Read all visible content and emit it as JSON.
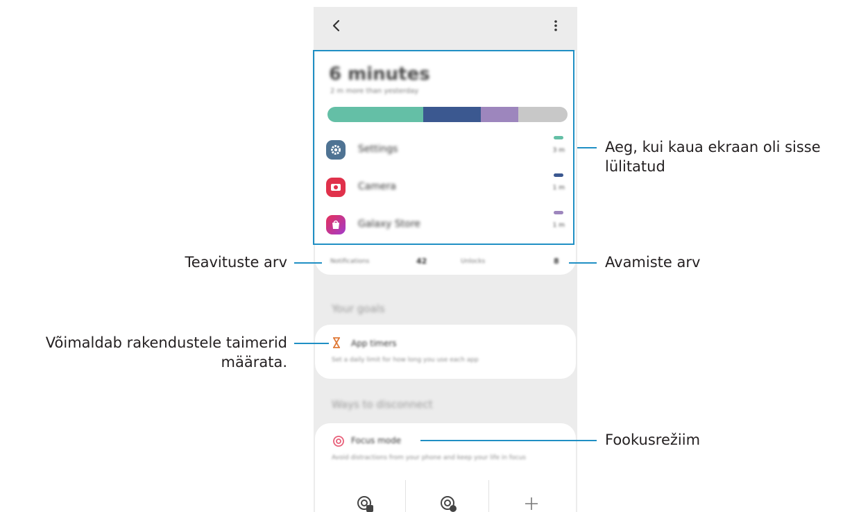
{
  "usage": {
    "total": "6 minutes",
    "compare": "2 m more than yesterday",
    "bar": [
      {
        "color": "#64bfa6",
        "fraction": 0.4
      },
      {
        "color": "#3b5890",
        "fraction": 0.24
      },
      {
        "color": "#9d86bd",
        "fraction": 0.155
      },
      {
        "color": "#c8c8c8",
        "fraction": 0.205
      }
    ]
  },
  "apps": [
    {
      "name": "Settings",
      "time": "3 m",
      "color": "#64bfa6",
      "icon": "gear-icon"
    },
    {
      "name": "Camera",
      "time": "1 m",
      "color": "#3b5890",
      "icon": "camera-icon"
    },
    {
      "name": "Galaxy Store",
      "time": "1 m",
      "color": "#9d86bd",
      "icon": "shopping-bag-icon"
    }
  ],
  "stats": {
    "notifications_label": "Notifications",
    "notifications_value": "42",
    "unlocks_label": "Unlocks",
    "unlocks_value": "8"
  },
  "goals": {
    "section": "Your goals",
    "app_timers_title": "App timers",
    "app_timers_desc": "Set a daily limit for how long you use each app"
  },
  "disconnect": {
    "section": "Ways to disconnect",
    "focus_title": "Focus mode",
    "focus_desc": "Avoid distractions from your phone and keep your life in focus"
  },
  "callouts": {
    "screen_time": "Aeg, kui kaua ekraan oli sisse\nlülitatud",
    "notifications": "Teavituste arv",
    "unlocks": "Avamiste arv",
    "app_timers": "Võimaldab rakendustele taimerid\nmäärata.",
    "focus_mode": "Fookusrežiim"
  },
  "colors": {
    "callout_line": "#1f8fc4",
    "focus_accent": "#e8607a",
    "timer_accent": "#e07b39"
  }
}
